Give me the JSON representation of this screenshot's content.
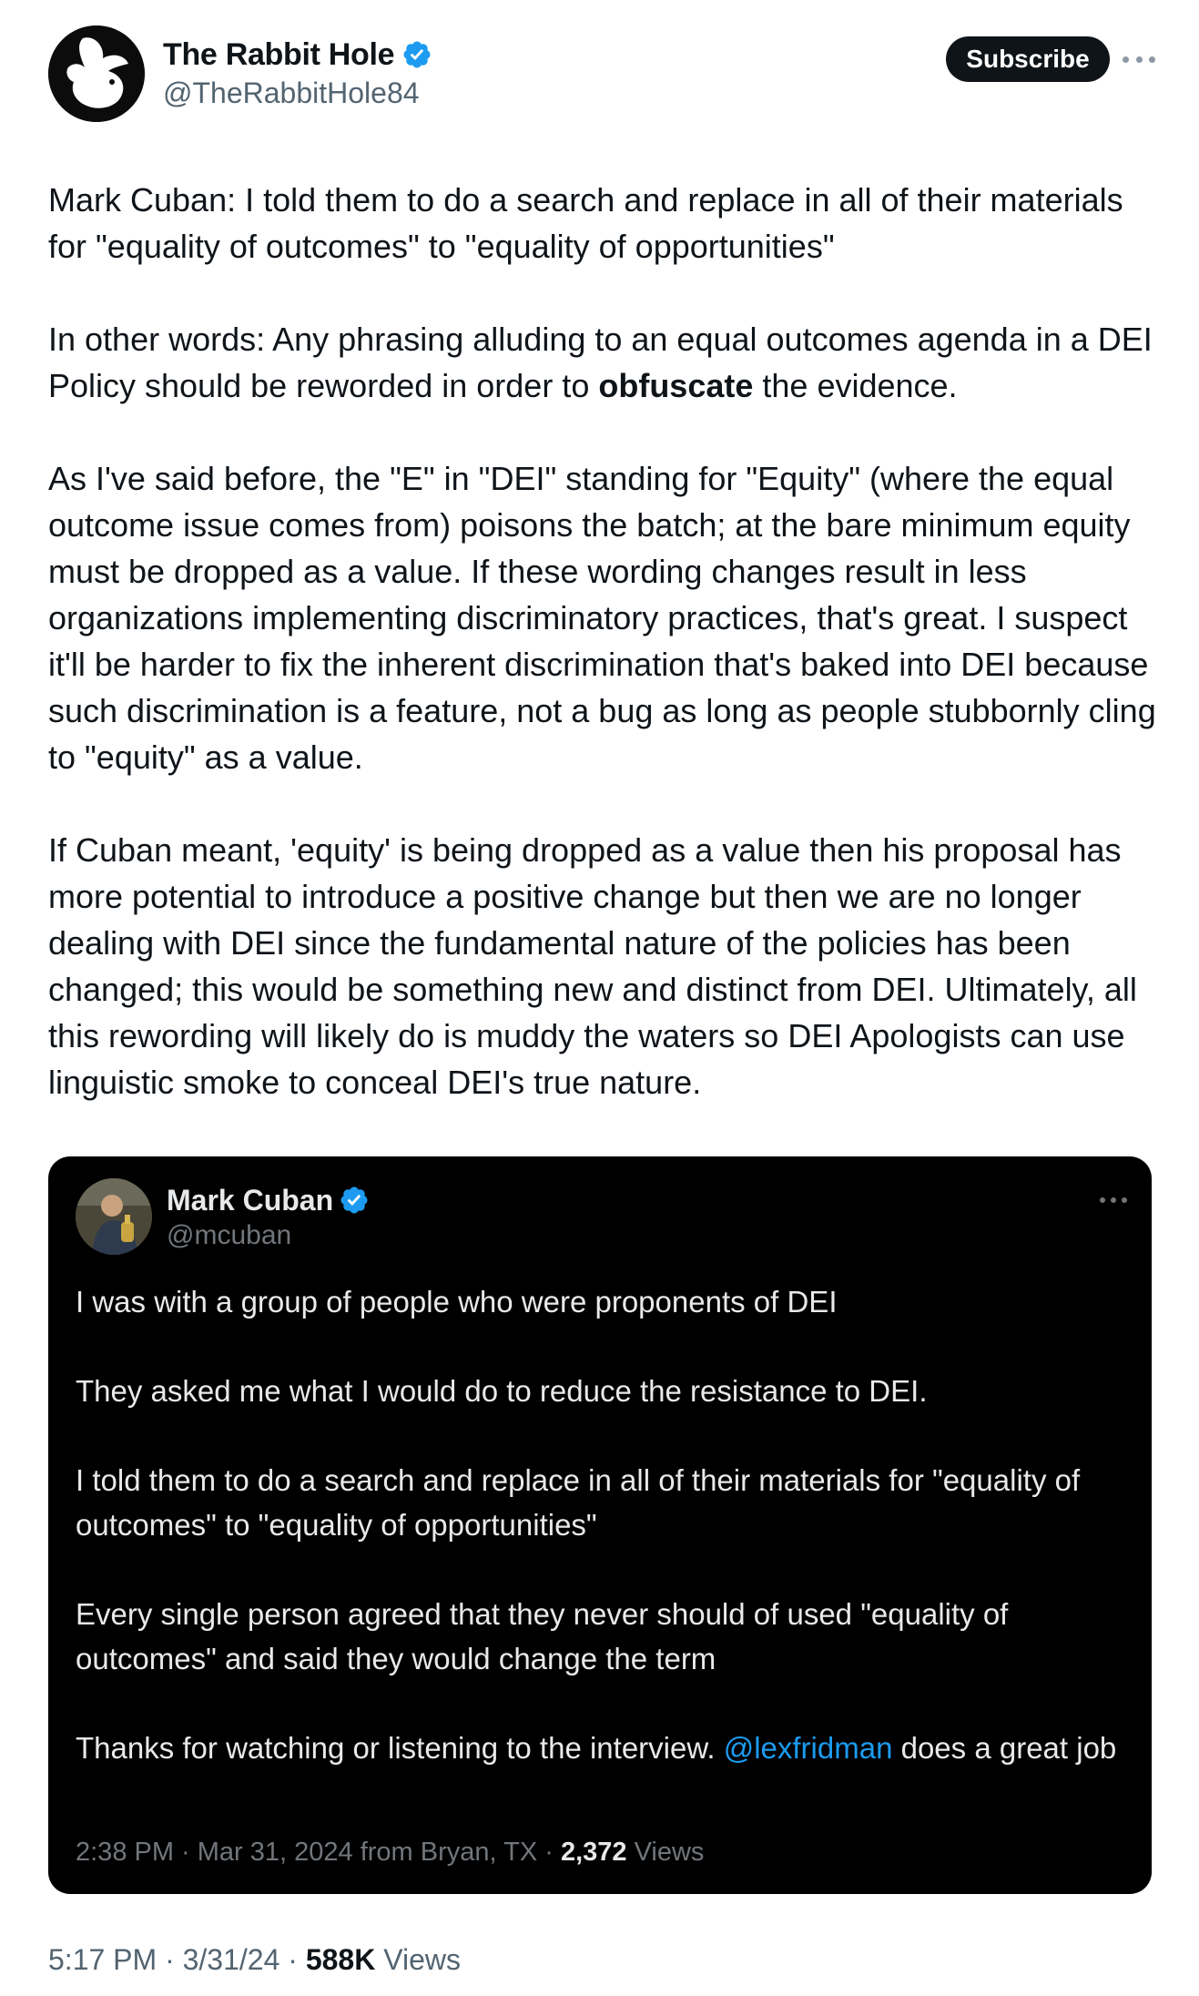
{
  "author": {
    "display_name": "The Rabbit Hole",
    "handle": "@TheRabbitHole84",
    "avatar_icon": "rabbit-logo-icon",
    "verified_icon": "verified-badge-icon",
    "verified_color": "#1d9bf0"
  },
  "header": {
    "subscribe_label": "Subscribe",
    "more_icon": "more-horizontal-icon"
  },
  "tweet": {
    "p1": "Mark Cuban: I told them to do a search and replace in all of their materials for \"equality of outcomes\" to \"equality of opportunities\"",
    "p2_before": "In other words: Any phrasing alluding to an equal outcomes agenda in a DEI Policy should be reworded in order to ",
    "p2_bold": "obfuscate",
    "p2_after": " the evidence.",
    "p3": "As I've said before, the \"E\" in \"DEI\" standing for \"Equity\" (where the equal outcome issue comes from) poisons the batch; at the bare minimum equity must be dropped as a value. If these wording changes result in less organizations implementing discriminatory practices, that's great. I suspect it'll be harder to fix the inherent discrimination that's baked into DEI because such discrimination is a feature, not a bug as long as people stubbornly cling to \"equity\" as a value.",
    "p4": "If Cuban meant, 'equity' is being dropped as a value then his proposal has more potential to introduce a positive change but then we are no longer dealing with DEI since the fundamental nature of the policies has been changed; this would be something new and distinct from DEI. Ultimately, all this rewording will likely do is muddy the waters so DEI Apologists can use linguistic smoke to conceal DEI's true nature."
  },
  "quoted": {
    "display_name": "Mark Cuban",
    "handle": "@mcuban",
    "avatar_icon": "profile-photo-icon",
    "more_icon": "more-horizontal-icon",
    "p1": "I was with a group of people who were proponents of DEI",
    "p2": "They asked me what I would do to reduce the resistance to DEI.",
    "p3": "I told them to do a search and replace in all of their materials for \"equality of outcomes\" to \"equality of opportunities\"",
    "p4": "Every single person agreed that  they never should of used \"equality of outcomes\" and said they would change the term",
    "p5_before": "Thanks for watching or listening to the interview.  ",
    "p5_mention": "@lexfridman",
    "p5_after": " does a great job",
    "meta_time": "2:38 PM · Mar 31, 2024 from Bryan, TX · ",
    "meta_views_count": "2,372",
    "meta_views_label": " Views"
  },
  "footer": {
    "time": "5:17 PM · 3/31/24 · ",
    "views_count": "588K",
    "views_label": " Views"
  },
  "colors": {
    "text_primary": "#0f1419",
    "text_secondary": "#536471",
    "quote_bg": "#000000",
    "quote_text": "#e7e9ea",
    "quote_secondary": "#71767b",
    "link": "#1d9bf0"
  }
}
